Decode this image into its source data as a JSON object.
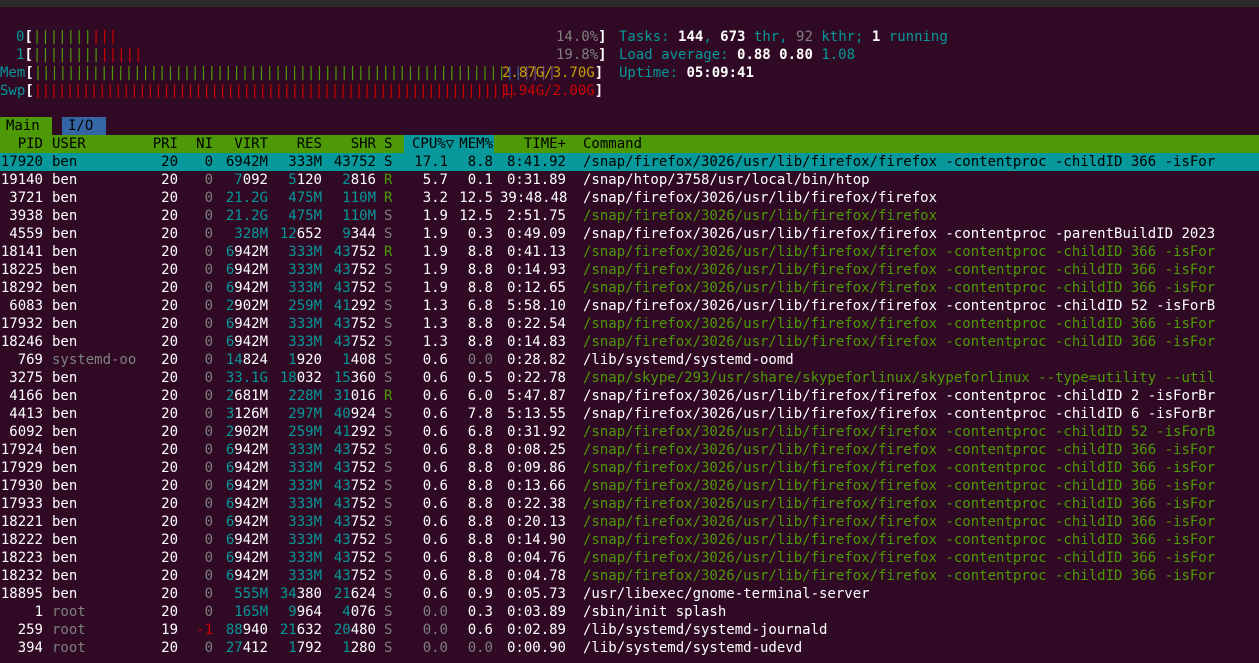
{
  "meters": {
    "cpu0": {
      "label": "0",
      "green": "|||||||",
      "red": "|||",
      "value": "14.0%"
    },
    "cpu1": {
      "label": "1",
      "green": "||||||||",
      "red": "|||||",
      "value": "19.8%"
    },
    "mem": {
      "label": "Mem",
      "green": "|||||||||||||||||||||||||||||||||||||||||||||||||||||||||",
      "blue": "||",
      "purple": "||||",
      "value": "2.87G/3.70G"
    },
    "swp": {
      "label": "Swp",
      "red": "||||||||||||||||||||||||||||||||||||||||||||||||||||||||||||",
      "value": "1.94G/2.00G"
    }
  },
  "stats": {
    "tasks_label": "Tasks: ",
    "tasks": "144",
    "thr": "673",
    "thr_label": " thr, ",
    "kthr": "92",
    "kthr_label": " kthr; ",
    "running": "1",
    "running_label": " running",
    "load_label": "Load average: ",
    "load1": "0.88",
    "load5": "0.80",
    "load15": "1.08",
    "uptime_label": "Uptime: ",
    "uptime": "05:09:41"
  },
  "tabs": {
    "main": "Main",
    "io": "I/O"
  },
  "columns": {
    "pid": "PID",
    "user": "USER",
    "pri": "PRI",
    "ni": "NI",
    "virt": "VIRT",
    "res": "RES",
    "shr": "SHR",
    "s": "S",
    "cpu": "CPU%▽",
    "mem": "MEM%",
    "time": "TIME+",
    "command": "Command"
  },
  "processes": [
    {
      "pid": "17920",
      "user": "ben",
      "pri": "20",
      "ni": "0",
      "virt": "6942M",
      "res": "333M",
      "shr": "43752",
      "s": "S",
      "cpu": "17.1",
      "mem": "8.8",
      "time": "8:41.92",
      "cmd": "/snap/firefox/3026/usr/lib/firefox/firefox -contentproc -childID 366 -isFor",
      "selected": true
    },
    {
      "pid": "19140",
      "user": "ben",
      "pri": "20",
      "ni": "0",
      "virt": "7092",
      "res": "5120",
      "shr": "2816",
      "s": "R",
      "cpu": "5.7",
      "mem": "0.1",
      "time": "0:31.89",
      "cmd": "/snap/htop/3758/usr/local/bin/htop"
    },
    {
      "pid": "3721",
      "user": "ben",
      "pri": "20",
      "ni": "0",
      "virt": "21.2G",
      "res": "475M",
      "shr": "110M",
      "s": "R",
      "cpu": "3.2",
      "mem": "12.5",
      "time": "39:48.48",
      "cmd": "/snap/firefox/3026/usr/lib/firefox/firefox"
    },
    {
      "pid": "3938",
      "user": "ben",
      "pri": "20",
      "ni": "0",
      "virt": "21.2G",
      "res": "475M",
      "shr": "110M",
      "s": "S",
      "cpu": "1.9",
      "mem": "12.5",
      "time": "2:51.75",
      "cmd": "/snap/firefox/3026/usr/lib/firefox/firefox",
      "thread": true
    },
    {
      "pid": "4559",
      "user": "ben",
      "pri": "20",
      "ni": "0",
      "virt": "328M",
      "res": "12652",
      "shr": "9344",
      "s": "S",
      "cpu": "1.9",
      "mem": "0.3",
      "time": "0:49.09",
      "cmd": "/snap/firefox/3026/usr/lib/firefox/firefox -contentproc -parentBuildID 2023"
    },
    {
      "pid": "18141",
      "user": "ben",
      "pri": "20",
      "ni": "0",
      "virt": "6942M",
      "res": "333M",
      "shr": "43752",
      "s": "R",
      "cpu": "1.9",
      "mem": "8.8",
      "time": "0:41.13",
      "cmd": "/snap/firefox/3026/usr/lib/firefox/firefox -contentproc -childID 366 -isFor",
      "thread": true
    },
    {
      "pid": "18225",
      "user": "ben",
      "pri": "20",
      "ni": "0",
      "virt": "6942M",
      "res": "333M",
      "shr": "43752",
      "s": "S",
      "cpu": "1.9",
      "mem": "8.8",
      "time": "0:14.93",
      "cmd": "/snap/firefox/3026/usr/lib/firefox/firefox -contentproc -childID 366 -isFor",
      "thread": true
    },
    {
      "pid": "18292",
      "user": "ben",
      "pri": "20",
      "ni": "0",
      "virt": "6942M",
      "res": "333M",
      "shr": "43752",
      "s": "S",
      "cpu": "1.9",
      "mem": "8.8",
      "time": "0:12.65",
      "cmd": "/snap/firefox/3026/usr/lib/firefox/firefox -contentproc -childID 366 -isFor",
      "thread": true
    },
    {
      "pid": "6083",
      "user": "ben",
      "pri": "20",
      "ni": "0",
      "virt": "2902M",
      "res": "259M",
      "shr": "41292",
      "s": "S",
      "cpu": "1.3",
      "mem": "6.8",
      "time": "5:58.10",
      "cmd": "/snap/firefox/3026/usr/lib/firefox/firefox -contentproc -childID 52 -isForB"
    },
    {
      "pid": "17932",
      "user": "ben",
      "pri": "20",
      "ni": "0",
      "virt": "6942M",
      "res": "333M",
      "shr": "43752",
      "s": "S",
      "cpu": "1.3",
      "mem": "8.8",
      "time": "0:22.54",
      "cmd": "/snap/firefox/3026/usr/lib/firefox/firefox -contentproc -childID 366 -isFor",
      "thread": true
    },
    {
      "pid": "18246",
      "user": "ben",
      "pri": "20",
      "ni": "0",
      "virt": "6942M",
      "res": "333M",
      "shr": "43752",
      "s": "S",
      "cpu": "1.3",
      "mem": "8.8",
      "time": "0:14.83",
      "cmd": "/snap/firefox/3026/usr/lib/firefox/firefox -contentproc -childID 366 -isFor",
      "thread": true
    },
    {
      "pid": "769",
      "user": "systemd-oo",
      "pri": "20",
      "ni": "0",
      "virt": "14824",
      "res": "1920",
      "shr": "1408",
      "s": "S",
      "cpu": "0.6",
      "mem": "0.0",
      "time": "0:28.82",
      "cmd": "/lib/systemd/systemd-oomd",
      "sysuser": true
    },
    {
      "pid": "3275",
      "user": "ben",
      "pri": "20",
      "ni": "0",
      "virt": "33.1G",
      "res": "18032",
      "shr": "15360",
      "s": "S",
      "cpu": "0.6",
      "mem": "0.5",
      "time": "0:22.78",
      "cmd": "/snap/skype/293/usr/share/skypeforlinux/skypeforlinux --type=utility --util",
      "thread": true
    },
    {
      "pid": "4166",
      "user": "ben",
      "pri": "20",
      "ni": "0",
      "virt": "2681M",
      "res": "228M",
      "shr": "31016",
      "s": "R",
      "cpu": "0.6",
      "mem": "6.0",
      "time": "5:47.87",
      "cmd": "/snap/firefox/3026/usr/lib/firefox/firefox -contentproc -childID 2 -isForBr"
    },
    {
      "pid": "4413",
      "user": "ben",
      "pri": "20",
      "ni": "0",
      "virt": "3126M",
      "res": "297M",
      "shr": "40924",
      "s": "S",
      "cpu": "0.6",
      "mem": "7.8",
      "time": "5:13.55",
      "cmd": "/snap/firefox/3026/usr/lib/firefox/firefox -contentproc -childID 6 -isForBr"
    },
    {
      "pid": "6092",
      "user": "ben",
      "pri": "20",
      "ni": "0",
      "virt": "2902M",
      "res": "259M",
      "shr": "41292",
      "s": "S",
      "cpu": "0.6",
      "mem": "6.8",
      "time": "0:31.92",
      "cmd": "/snap/firefox/3026/usr/lib/firefox/firefox -contentproc -childID 52 -isForB",
      "thread": true
    },
    {
      "pid": "17924",
      "user": "ben",
      "pri": "20",
      "ni": "0",
      "virt": "6942M",
      "res": "333M",
      "shr": "43752",
      "s": "S",
      "cpu": "0.6",
      "mem": "8.8",
      "time": "0:08.25",
      "cmd": "/snap/firefox/3026/usr/lib/firefox/firefox -contentproc -childID 366 -isFor",
      "thread": true
    },
    {
      "pid": "17929",
      "user": "ben",
      "pri": "20",
      "ni": "0",
      "virt": "6942M",
      "res": "333M",
      "shr": "43752",
      "s": "S",
      "cpu": "0.6",
      "mem": "8.8",
      "time": "0:09.86",
      "cmd": "/snap/firefox/3026/usr/lib/firefox/firefox -contentproc -childID 366 -isFor",
      "thread": true
    },
    {
      "pid": "17930",
      "user": "ben",
      "pri": "20",
      "ni": "0",
      "virt": "6942M",
      "res": "333M",
      "shr": "43752",
      "s": "S",
      "cpu": "0.6",
      "mem": "8.8",
      "time": "0:13.66",
      "cmd": "/snap/firefox/3026/usr/lib/firefox/firefox -contentproc -childID 366 -isFor",
      "thread": true
    },
    {
      "pid": "17933",
      "user": "ben",
      "pri": "20",
      "ni": "0",
      "virt": "6942M",
      "res": "333M",
      "shr": "43752",
      "s": "S",
      "cpu": "0.6",
      "mem": "8.8",
      "time": "0:22.38",
      "cmd": "/snap/firefox/3026/usr/lib/firefox/firefox -contentproc -childID 366 -isFor",
      "thread": true
    },
    {
      "pid": "18221",
      "user": "ben",
      "pri": "20",
      "ni": "0",
      "virt": "6942M",
      "res": "333M",
      "shr": "43752",
      "s": "S",
      "cpu": "0.6",
      "mem": "8.8",
      "time": "0:20.13",
      "cmd": "/snap/firefox/3026/usr/lib/firefox/firefox -contentproc -childID 366 -isFor",
      "thread": true
    },
    {
      "pid": "18222",
      "user": "ben",
      "pri": "20",
      "ni": "0",
      "virt": "6942M",
      "res": "333M",
      "shr": "43752",
      "s": "S",
      "cpu": "0.6",
      "mem": "8.8",
      "time": "0:14.90",
      "cmd": "/snap/firefox/3026/usr/lib/firefox/firefox -contentproc -childID 366 -isFor",
      "thread": true
    },
    {
      "pid": "18223",
      "user": "ben",
      "pri": "20",
      "ni": "0",
      "virt": "6942M",
      "res": "333M",
      "shr": "43752",
      "s": "S",
      "cpu": "0.6",
      "mem": "8.8",
      "time": "0:04.76",
      "cmd": "/snap/firefox/3026/usr/lib/firefox/firefox -contentproc -childID 366 -isFor",
      "thread": true
    },
    {
      "pid": "18232",
      "user": "ben",
      "pri": "20",
      "ni": "0",
      "virt": "6942M",
      "res": "333M",
      "shr": "43752",
      "s": "S",
      "cpu": "0.6",
      "mem": "8.8",
      "time": "0:04.78",
      "cmd": "/snap/firefox/3026/usr/lib/firefox/firefox -contentproc -childID 366 -isFor",
      "thread": true
    },
    {
      "pid": "18895",
      "user": "ben",
      "pri": "20",
      "ni": "0",
      "virt": "555M",
      "res": "34380",
      "shr": "21624",
      "s": "S",
      "cpu": "0.6",
      "mem": "0.9",
      "time": "0:05.73",
      "cmd": "/usr/libexec/gnome-terminal-server"
    },
    {
      "pid": "1",
      "user": "root",
      "pri": "20",
      "ni": "0",
      "virt": "165M",
      "res": "9964",
      "shr": "4076",
      "s": "S",
      "cpu": "0.0",
      "mem": "0.3",
      "time": "0:03.89",
      "cmd": "/sbin/init splash",
      "sysuser": true,
      "zerocpu": true
    },
    {
      "pid": "259",
      "user": "root",
      "pri": "19",
      "ni": "-1",
      "virt": "88940",
      "res": "21632",
      "shr": "20480",
      "s": "S",
      "cpu": "0.0",
      "mem": "0.6",
      "time": "0:02.89",
      "cmd": "/lib/systemd/systemd-journald",
      "sysuser": true,
      "zerocpu": true,
      "negni": true
    },
    {
      "pid": "394",
      "user": "root",
      "pri": "20",
      "ni": "0",
      "virt": "27412",
      "res": "1792",
      "shr": "1280",
      "s": "S",
      "cpu": "0.0",
      "mem": "0.0",
      "time": "0:00.90",
      "cmd": "/lib/systemd/systemd-udevd",
      "sysuser": true,
      "zerocpu": true
    }
  ]
}
